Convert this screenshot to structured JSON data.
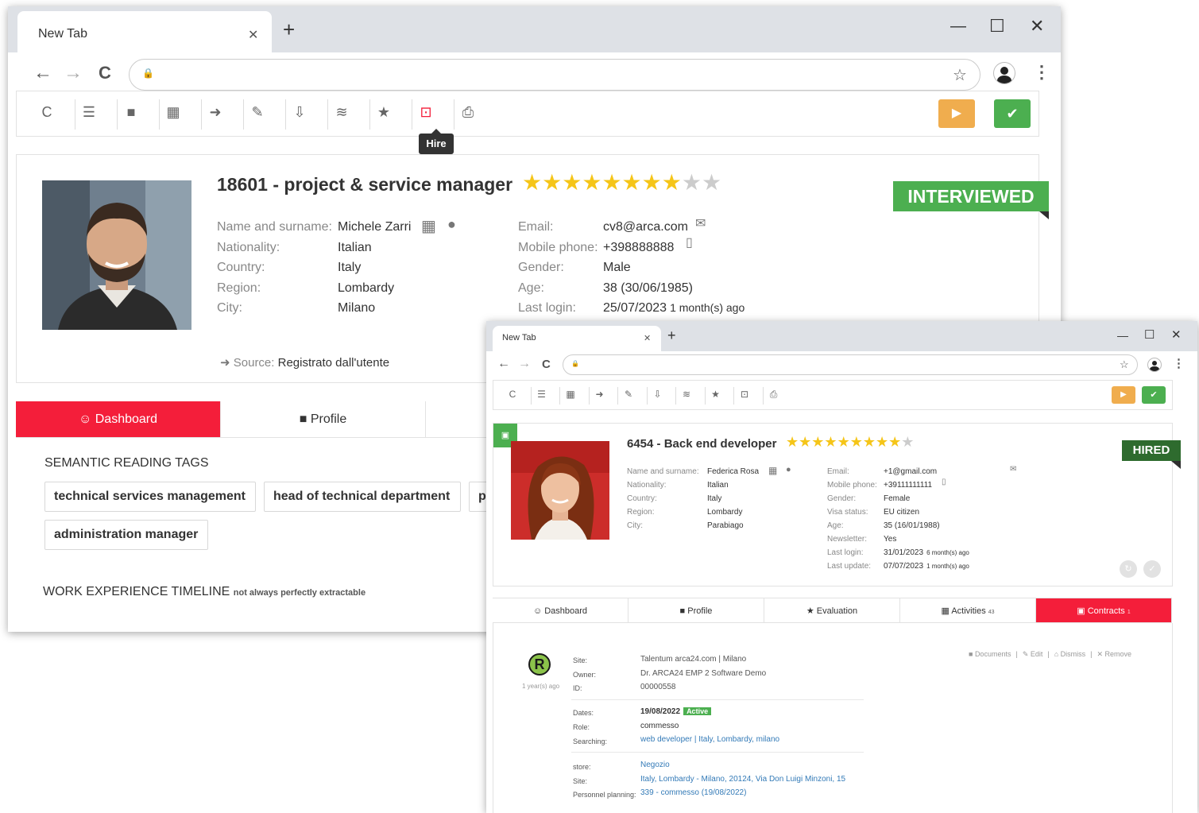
{
  "window1": {
    "tab_title": "New Tab",
    "tab_close": "✕",
    "new_tab": "+",
    "controls": {
      "minimize": "—",
      "maximize": "☐",
      "close": "✕"
    },
    "nav": {
      "back": "←",
      "forward": "→",
      "reload": "C",
      "lock": "🔒",
      "star": "☆",
      "menu": "⋮"
    },
    "toolbar": {
      "icons": [
        "reload-icon",
        "list-icon",
        "video-icon",
        "doc-icon",
        "share-icon",
        "pencil-icon",
        "inbox-icon",
        "stack-icon",
        "star-icon",
        "hire-icon",
        "print-icon"
      ],
      "glyphs": [
        "C",
        "☰",
        "■",
        "▦",
        "➜",
        "✎",
        "⇩",
        "≋",
        "★",
        "⊡",
        "⎙"
      ],
      "play": "▶",
      "ok": "✔",
      "tooltip": "Hire"
    },
    "candidate": {
      "title": "18601 - project & service manager",
      "stars_on": 8,
      "stars_total": 10,
      "status": "INTERVIEWED",
      "status_color": "#4caf50",
      "fields_left": [
        {
          "label": "Name and surname:",
          "value": "Michele Zarri"
        },
        {
          "label": "Nationality:",
          "value": "Italian"
        },
        {
          "label": "Country:",
          "value": "Italy"
        },
        {
          "label": "Region:",
          "value": "Lombardy"
        },
        {
          "label": "City:",
          "value": "Milano"
        }
      ],
      "fields_right": [
        {
          "label": "Email:",
          "value": "cv8@arca.com"
        },
        {
          "label": "Mobile phone:",
          "value": "+398888888"
        },
        {
          "label": "Gender:",
          "value": "Male"
        },
        {
          "label": "Age:",
          "value": "38 (30/06/1985)"
        },
        {
          "label": "Last login:",
          "value": "25/07/2023",
          "suffix": "1 month(s) ago"
        }
      ],
      "source_label": "Source:",
      "source_value": "Registrato dall'utente"
    },
    "tabs": [
      {
        "icon": "☺",
        "label": "Dashboard",
        "active": true
      },
      {
        "icon": "■",
        "label": "Profile",
        "active": false
      }
    ],
    "semantic_title": "SEMANTIC READING TAGS",
    "tags": [
      "technical services management",
      "head of technical department",
      "p",
      "administration manager"
    ],
    "timeline_title": "WORK EXPERIENCE TIMELINE",
    "timeline_note": "not always perfectly extractable"
  },
  "window2": {
    "tab_title": "New Tab",
    "tab_close": "✕",
    "new_tab": "+",
    "controls": {
      "minimize": "—",
      "maximize": "☐",
      "close": "✕"
    },
    "nav": {
      "back": "←",
      "forward": "→",
      "reload": "C",
      "lock": "🔒",
      "star": "☆",
      "menu": "⋮"
    },
    "toolbar": {
      "glyphs": [
        "C",
        "☰",
        "▦",
        "➜",
        "✎",
        "⇩",
        "≋",
        "★",
        "⊡",
        "⎙"
      ],
      "play": "▶",
      "ok": "✔"
    },
    "candidate": {
      "title": "6454 - Back end developer",
      "stars_on": 9,
      "stars_total": 10,
      "status": "HIRED",
      "status_color": "#2e6b2e",
      "fields_left": [
        {
          "label": "Name and surname:",
          "value": "Federica Rosa"
        },
        {
          "label": "Nationality:",
          "value": "Italian"
        },
        {
          "label": "Country:",
          "value": "Italy"
        },
        {
          "label": "Region:",
          "value": "Lombardy"
        },
        {
          "label": "City:",
          "value": "Parabiago"
        }
      ],
      "fields_right": [
        {
          "label": "Email:",
          "value": "+1@gmail.com"
        },
        {
          "label": "Mobile phone:",
          "value": "+39111111111"
        },
        {
          "label": "Gender:",
          "value": "Female"
        },
        {
          "label": "Visa status:",
          "value": "EU citizen"
        },
        {
          "label": "Age:",
          "value": "35 (16/01/1988)"
        },
        {
          "label": "Newsletter:",
          "value": "Yes"
        },
        {
          "label": "Last login:",
          "value": "31/01/2023",
          "suffix": "6 month(s) ago"
        },
        {
          "label": "Last update:",
          "value": "07/07/2023",
          "suffix": "1 month(s) ago"
        }
      ]
    },
    "tabs": [
      {
        "icon": "☺",
        "label": "Dashboard",
        "count": ""
      },
      {
        "icon": "■",
        "label": "Profile",
        "count": ""
      },
      {
        "icon": "★",
        "label": "Evaluation",
        "count": ""
      },
      {
        "icon": "▦",
        "label": "Activities",
        "count": "43"
      },
      {
        "icon": "▣",
        "label": "Contracts",
        "count": "1"
      }
    ],
    "contract": {
      "logo": "R",
      "ago": "1 year(s) ago",
      "actions": [
        "Documents",
        "Edit",
        "Dismiss",
        "Remove"
      ],
      "block1": [
        {
          "label": "Site:",
          "value": "Talentum arca24.com | Milano"
        },
        {
          "label": "Owner:",
          "value": "Dr. ARCA24 EMP 2 Software Demo"
        },
        {
          "label": "ID:",
          "value": "00000558"
        }
      ],
      "dates_label": "Dates:",
      "dates_value": "19/08/2022",
      "dates_badge": "Active",
      "role_label": "Role:",
      "role_value": "commesso",
      "searching_label": "Searching:",
      "searching_value": "web developer | Italy, Lombardy, milano",
      "store_label": "store:",
      "store_value": "Negozio",
      "site2_label": "Site:",
      "site2_value": "Italy, Lombardy - Milano, 20124, Via Don Luigi Minzoni, 15",
      "planning_label": "Personnel planning:",
      "planning_value": "339 - commesso (19/08/2022)"
    }
  }
}
